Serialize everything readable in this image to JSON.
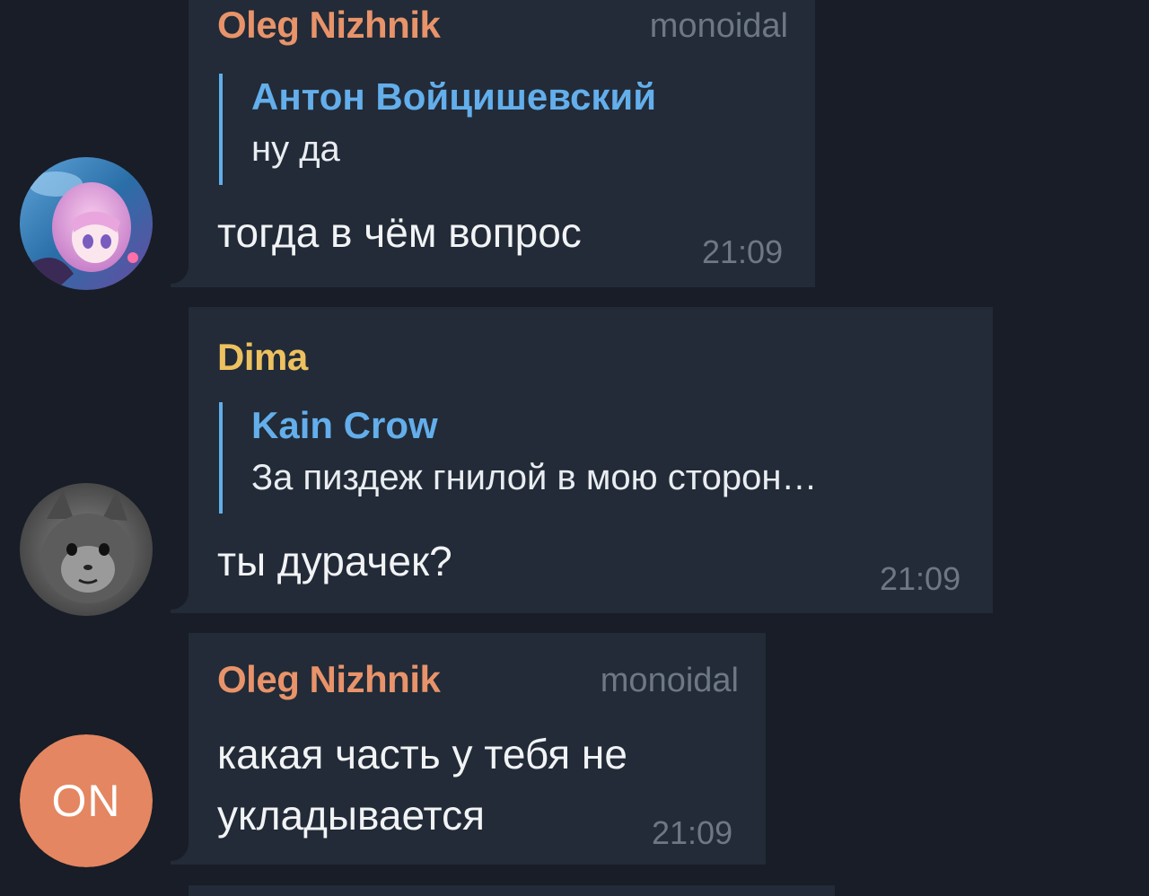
{
  "messages": [
    {
      "sender": "Oleg Nizhnik",
      "sender_color": "#e8936a",
      "admin_title": "monoidal",
      "reply": {
        "name": "Антон Войцишевский",
        "text": "ну да"
      },
      "text": "тогда в чём вопрос",
      "time": "21:09",
      "avatar": "anime-girl-avatar"
    },
    {
      "sender": "Dima",
      "sender_color": "#edc15f",
      "reply": {
        "name": "Kain Crow",
        "text": "За пиздеж гнилой в мою сторон…"
      },
      "text": "ты дурачек?",
      "time": "21:09",
      "avatar": "cat-photo-avatar"
    },
    {
      "sender": "Oleg Nizhnik",
      "sender_color": "#e8936a",
      "admin_title": "monoidal",
      "text_lines": [
        "какая часть у тебя не",
        "укладывается"
      ],
      "time": "21:09",
      "avatar_initials": "ON",
      "avatar_color": "#e48661"
    }
  ],
  "colors": {
    "background": "#181d27",
    "bubble": "#222b37",
    "reply_accent": "#60aeea",
    "meta_text": "#6e7883"
  }
}
